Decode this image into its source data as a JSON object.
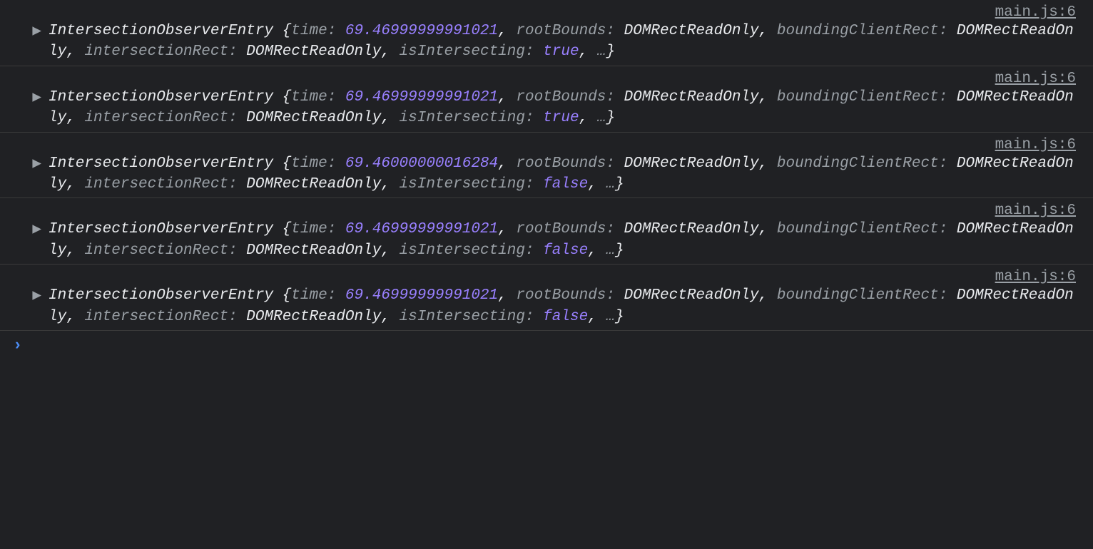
{
  "entries": [
    {
      "source": "main.js:6",
      "className": "IntersectionObserverEntry",
      "time": "69.46999999991021",
      "rootBounds": "DOMRectReadOnly",
      "boundingClientRect": "DOMRectReadOnly",
      "intersectionRect": "DOMRectReadOnly",
      "isIntersecting": "true"
    },
    {
      "source": "main.js:6",
      "className": "IntersectionObserverEntry",
      "time": "69.46999999991021",
      "rootBounds": "DOMRectReadOnly",
      "boundingClientRect": "DOMRectReadOnly",
      "intersectionRect": "DOMRectReadOnly",
      "isIntersecting": "true"
    },
    {
      "source": "main.js:6",
      "className": "IntersectionObserverEntry",
      "time": "69.46000000016284",
      "rootBounds": "DOMRectReadOnly",
      "boundingClientRect": "DOMRectReadOnly",
      "intersectionRect": "DOMRectReadOnly",
      "isIntersecting": "false"
    },
    {
      "source": "main.js:6",
      "className": "IntersectionObserverEntry",
      "time": "69.46999999991021",
      "rootBounds": "DOMRectReadOnly",
      "boundingClientRect": "DOMRectReadOnly",
      "intersectionRect": "DOMRectReadOnly",
      "isIntersecting": "false"
    },
    {
      "source": "main.js:6",
      "className": "IntersectionObserverEntry",
      "time": "69.46999999991021",
      "rootBounds": "DOMRectReadOnly",
      "boundingClientRect": "DOMRectReadOnly",
      "intersectionRect": "DOMRectReadOnly",
      "isIntersecting": "false"
    }
  ],
  "labels": {
    "time": "time:",
    "rootBounds": "rootBounds:",
    "boundingClientRect": "boundingClientRect:",
    "intersectionRect": "intersectionRect:",
    "isIntersecting": "isIntersecting:"
  },
  "glyphs": {
    "expand": "▶",
    "ellipsis": "…",
    "prompt": "›"
  }
}
